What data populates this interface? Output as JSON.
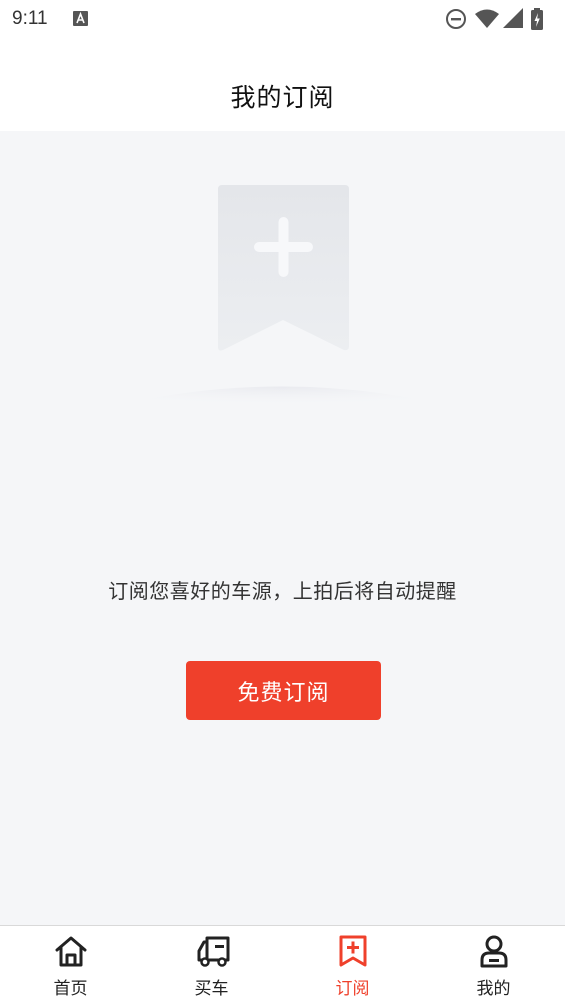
{
  "status_bar": {
    "time": "9:11",
    "icons": [
      "text-a-icon",
      "do-not-disturb-icon",
      "wifi-icon",
      "signal-icon",
      "battery-icon"
    ]
  },
  "header": {
    "title": "我的订阅"
  },
  "empty_state": {
    "illustration": "bookmark-plus-icon",
    "message": "订阅您喜好的车源，上拍后将自动提醒",
    "button_label": "免费订阅"
  },
  "tabbar": {
    "items": [
      {
        "label": "首页",
        "icon": "home-icon"
      },
      {
        "label": "买车",
        "icon": "truck-icon"
      },
      {
        "label": "订阅",
        "icon": "bookmark-plus-icon",
        "active": true
      },
      {
        "label": "我的",
        "icon": "person-icon"
      }
    ]
  },
  "colors": {
    "accent": "#ef402b",
    "background": "#f5f6f8",
    "surface": "#ffffff"
  }
}
